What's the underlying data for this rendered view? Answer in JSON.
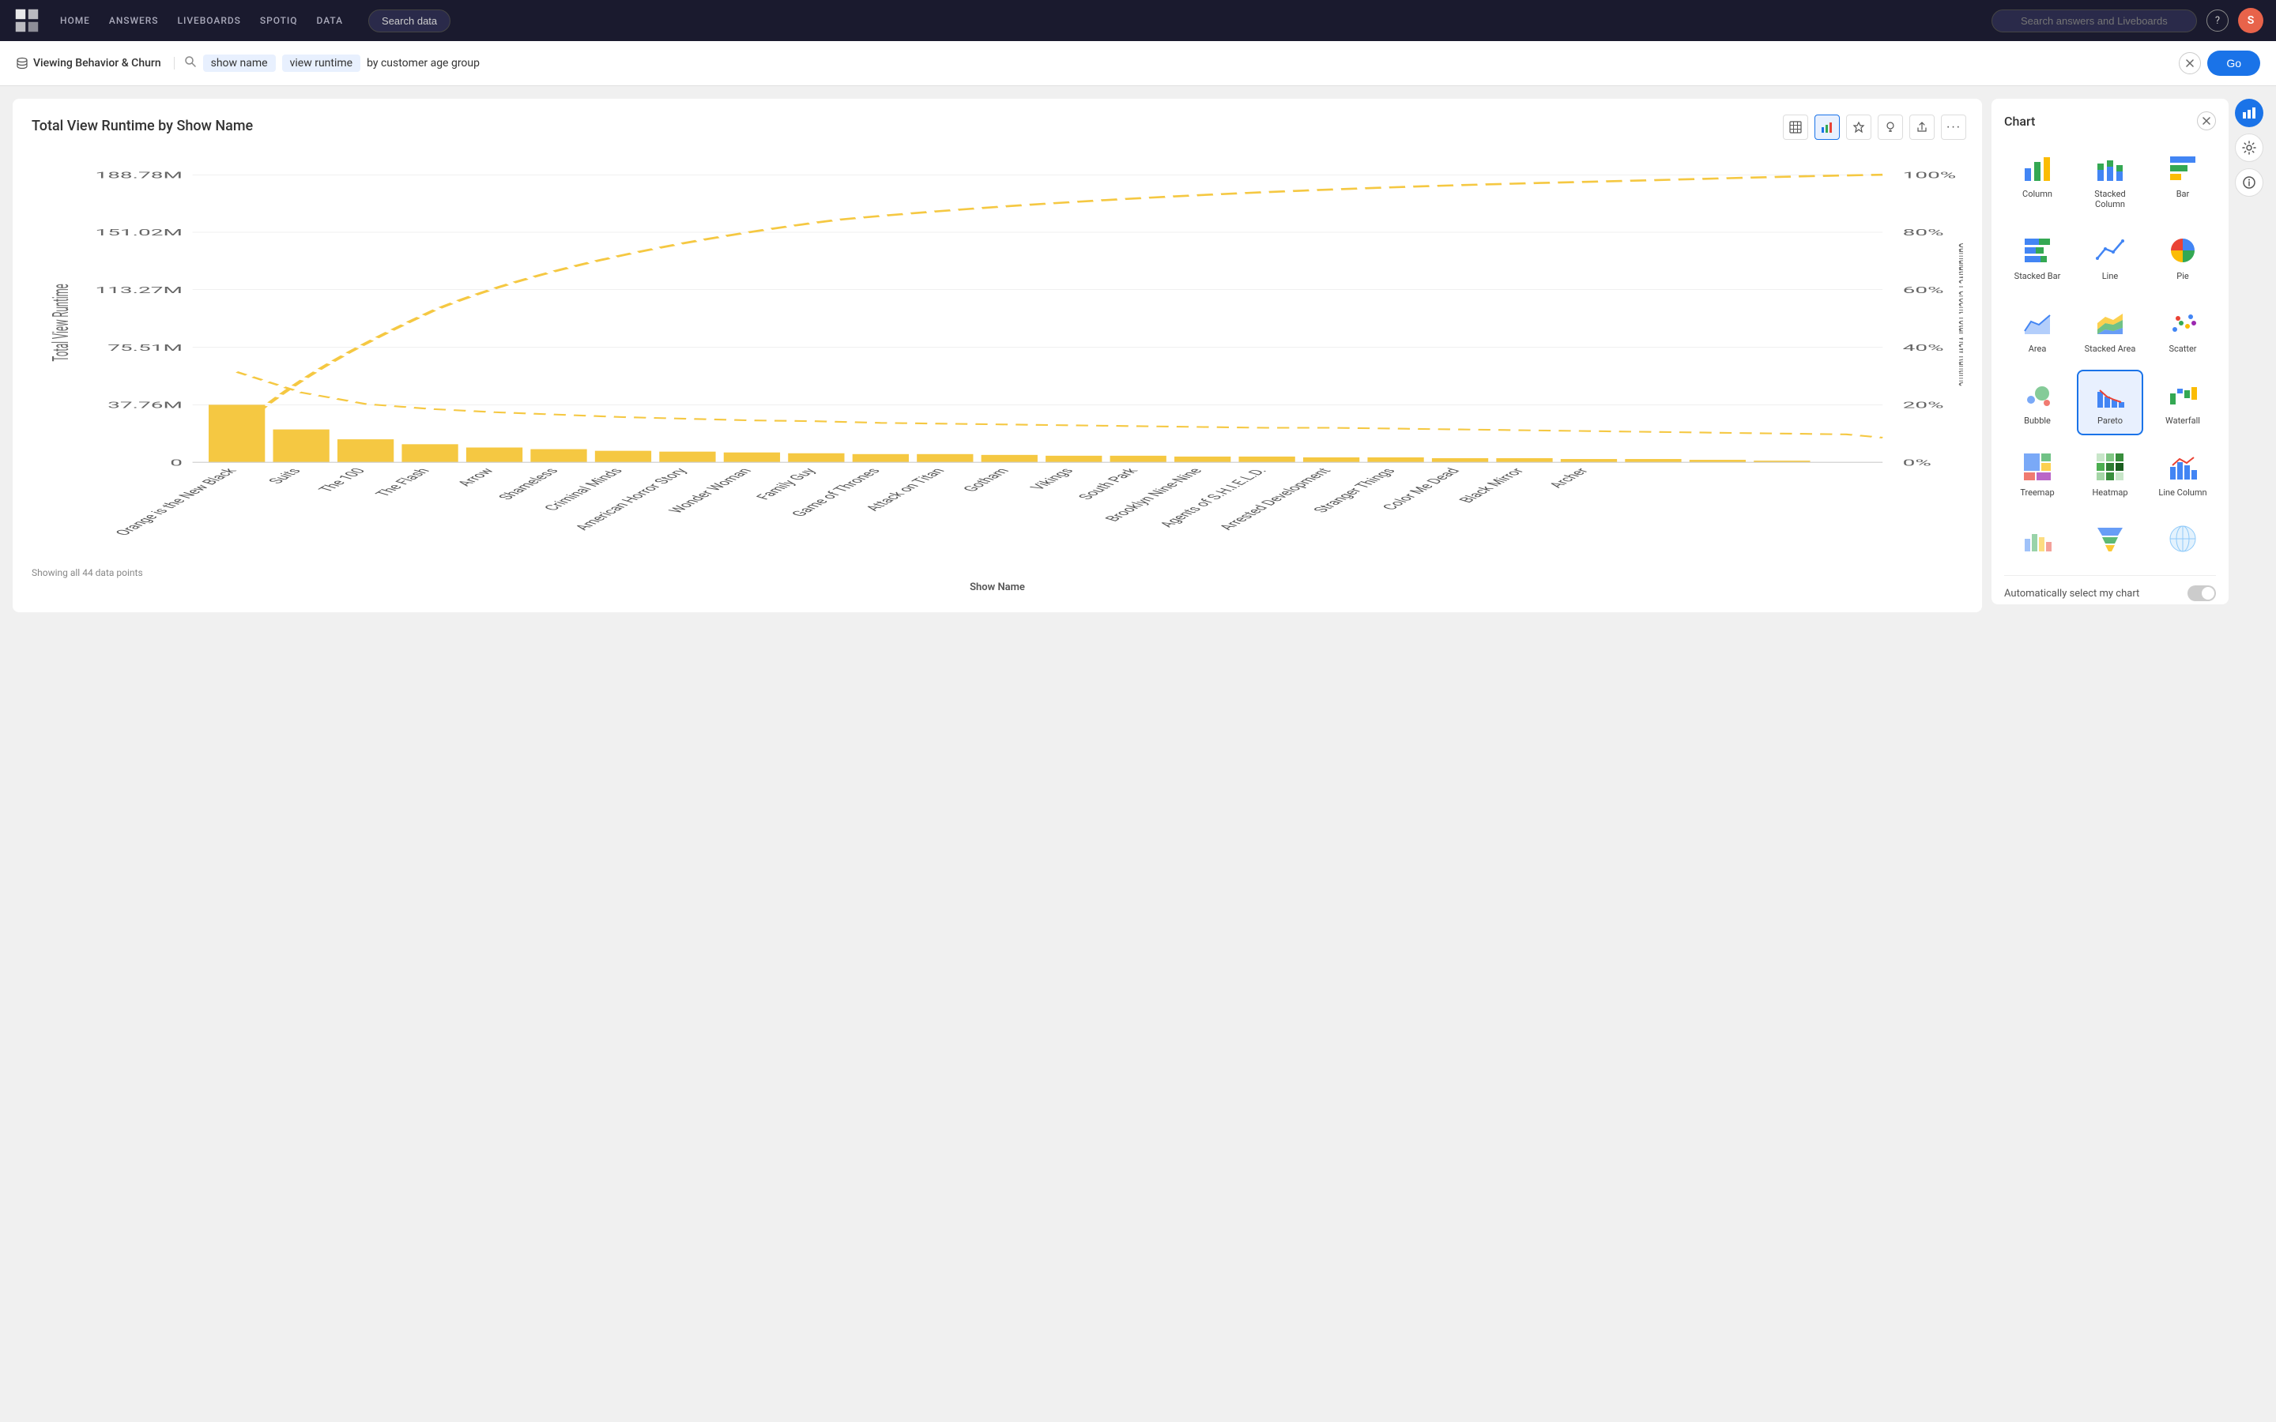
{
  "navbar": {
    "links": [
      {
        "id": "home",
        "label": "HOME"
      },
      {
        "id": "answers",
        "label": "ANSWERS"
      },
      {
        "id": "liveboards",
        "label": "LIVEBOARDS"
      },
      {
        "id": "spotiq",
        "label": "SPOTIQ"
      },
      {
        "id": "data",
        "label": "DATA"
      }
    ],
    "search_data_label": "Search data",
    "search_answers_placeholder": "Search answers and Liveboards",
    "help_icon": "?",
    "avatar_initials": "S"
  },
  "search_bar": {
    "datasource": "Viewing Behavior & Churn",
    "tokens": [
      {
        "type": "token",
        "value": "show name"
      },
      {
        "type": "token",
        "value": "view runtime"
      },
      {
        "type": "plain",
        "value": "by customer age group"
      }
    ],
    "clear_title": "clear",
    "go_label": "Go"
  },
  "chart": {
    "title": "Total View Runtime by Show Name",
    "y_axis_label": "Total View Runtime",
    "y_axis_right_label": "Cumulative Percent Total View Runtime",
    "x_axis_label": "Show Name",
    "footer": "Showing all 44 data points",
    "y_ticks": [
      "188.78M",
      "151.02M",
      "113.27M",
      "75.51M",
      "37.76M",
      "0"
    ],
    "y_pct_ticks": [
      "100%",
      "80%",
      "60%",
      "40%",
      "20%",
      "0%"
    ],
    "x_labels": [
      "Orange is the New Black",
      "Suits",
      "The 100",
      "The Flash",
      "Arrow",
      "Shameless",
      "Criminal Minds",
      "American Horror Story",
      "Wonder Woman",
      "Family Guy",
      "Game of Thrones",
      "Attack on Titan",
      "Gotham",
      "Vikings",
      "South Park",
      "Brooklyn Nine-Nine",
      "Agents of S.H.I.E.L.D.",
      "Arrested Development",
      "Stranger Things",
      "Color Me Dead",
      "Black Mirror",
      "Archer"
    ],
    "toolbar": {
      "table_icon": "≡",
      "chart_icon": "📊",
      "pin_icon": "📌",
      "lightbulb_icon": "💡",
      "share_icon": "↑",
      "more_icon": "⋯"
    }
  },
  "chart_panel": {
    "title": "Chart",
    "close_label": "×",
    "types": [
      {
        "id": "column",
        "label": "Column",
        "selected": false
      },
      {
        "id": "stacked-column",
        "label": "Stacked Column",
        "selected": false
      },
      {
        "id": "bar",
        "label": "Bar",
        "selected": false
      },
      {
        "id": "stacked-bar",
        "label": "Stacked Bar",
        "selected": false
      },
      {
        "id": "line",
        "label": "Line",
        "selected": false
      },
      {
        "id": "pie",
        "label": "Pie",
        "selected": false
      },
      {
        "id": "area",
        "label": "Area",
        "selected": false
      },
      {
        "id": "stacked-area",
        "label": "Stacked Area",
        "selected": false
      },
      {
        "id": "scatter",
        "label": "Scatter",
        "selected": false
      },
      {
        "id": "bubble",
        "label": "Bubble",
        "selected": false
      },
      {
        "id": "pareto",
        "label": "Pareto",
        "selected": true
      },
      {
        "id": "waterfall",
        "label": "Waterfall",
        "selected": false
      },
      {
        "id": "treemap",
        "label": "Treemap",
        "selected": false
      },
      {
        "id": "heatmap",
        "label": "Heatmap",
        "selected": false
      },
      {
        "id": "line-column",
        "label": "Line Column",
        "selected": false
      },
      {
        "id": "row1",
        "label": "",
        "selected": false
      },
      {
        "id": "funnel",
        "label": "",
        "selected": false
      },
      {
        "id": "geo",
        "label": "",
        "selected": false
      }
    ],
    "auto_select_label": "Automatically select my chart",
    "auto_select_on": false
  }
}
